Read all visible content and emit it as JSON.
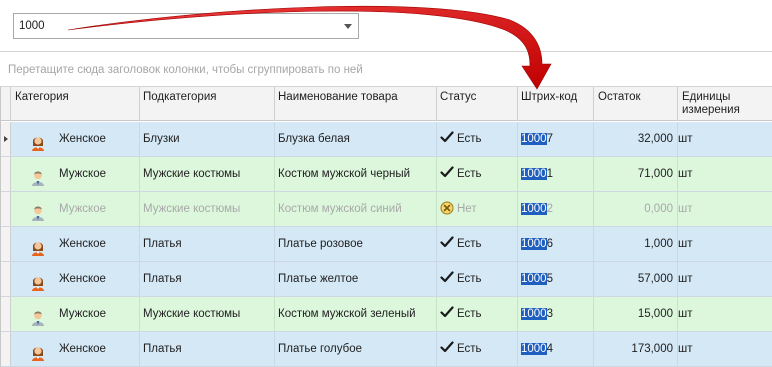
{
  "search": {
    "value": "1000"
  },
  "group_panel": {
    "hint": "Перетащите сюда заголовок колонки, чтобы сгруппировать по ней"
  },
  "columns": {
    "category": "Категория",
    "subcategory": "Подкатегория",
    "name": "Наименование товара",
    "status": "Статус",
    "barcode": "Штрих-код",
    "rest": "Остаток",
    "unit": "Единицы измерения"
  },
  "colors": {
    "row_blue": "#d5e8f6",
    "row_green": "#ddf7dd",
    "highlight": "#1f5fbf",
    "arrow": "#e01010"
  },
  "rows": [
    {
      "category": "Женское",
      "icon": "female-user-icon",
      "subcategory": "Блузки",
      "name": "Блузка белая",
      "status": "Есть",
      "bar_hl": "1000",
      "bar_rest": "7",
      "rest": "32,000",
      "unit": "шт"
    },
    {
      "category": "Мужское",
      "icon": "male-user-icon",
      "subcategory": "Мужские костюмы",
      "name": "Костюм мужской черный",
      "status": "Есть",
      "bar_hl": "1000",
      "bar_rest": "1",
      "rest": "71,000",
      "unit": "шт"
    },
    {
      "category": "Мужское",
      "icon": "male-user-icon",
      "subcategory": "Мужские костюмы",
      "name": "Костюм мужской синий",
      "status": "Нет",
      "bar_hl": "1000",
      "bar_rest": "2",
      "rest": "0,000",
      "unit": "шт"
    },
    {
      "category": "Женское",
      "icon": "female-user-icon",
      "subcategory": "Платья",
      "name": "Платье розовое",
      "status": "Есть",
      "bar_hl": "1000",
      "bar_rest": "6",
      "rest": "1,000",
      "unit": "шт"
    },
    {
      "category": "Женское",
      "icon": "female-user-icon",
      "subcategory": "Платья",
      "name": "Платье желтое",
      "status": "Есть",
      "bar_hl": "1000",
      "bar_rest": "5",
      "rest": "57,000",
      "unit": "шт"
    },
    {
      "category": "Мужское",
      "icon": "male-user-icon",
      "subcategory": "Мужские костюмы",
      "name": "Костюм мужской зеленый",
      "status": "Есть",
      "bar_hl": "1000",
      "bar_rest": "3",
      "rest": "15,000",
      "unit": "шт"
    },
    {
      "category": "Женское",
      "icon": "female-user-icon",
      "subcategory": "Платья",
      "name": "Платье голубое",
      "status": "Есть",
      "bar_hl": "1000",
      "bar_rest": "4",
      "rest": "173,000",
      "unit": "шт"
    }
  ]
}
